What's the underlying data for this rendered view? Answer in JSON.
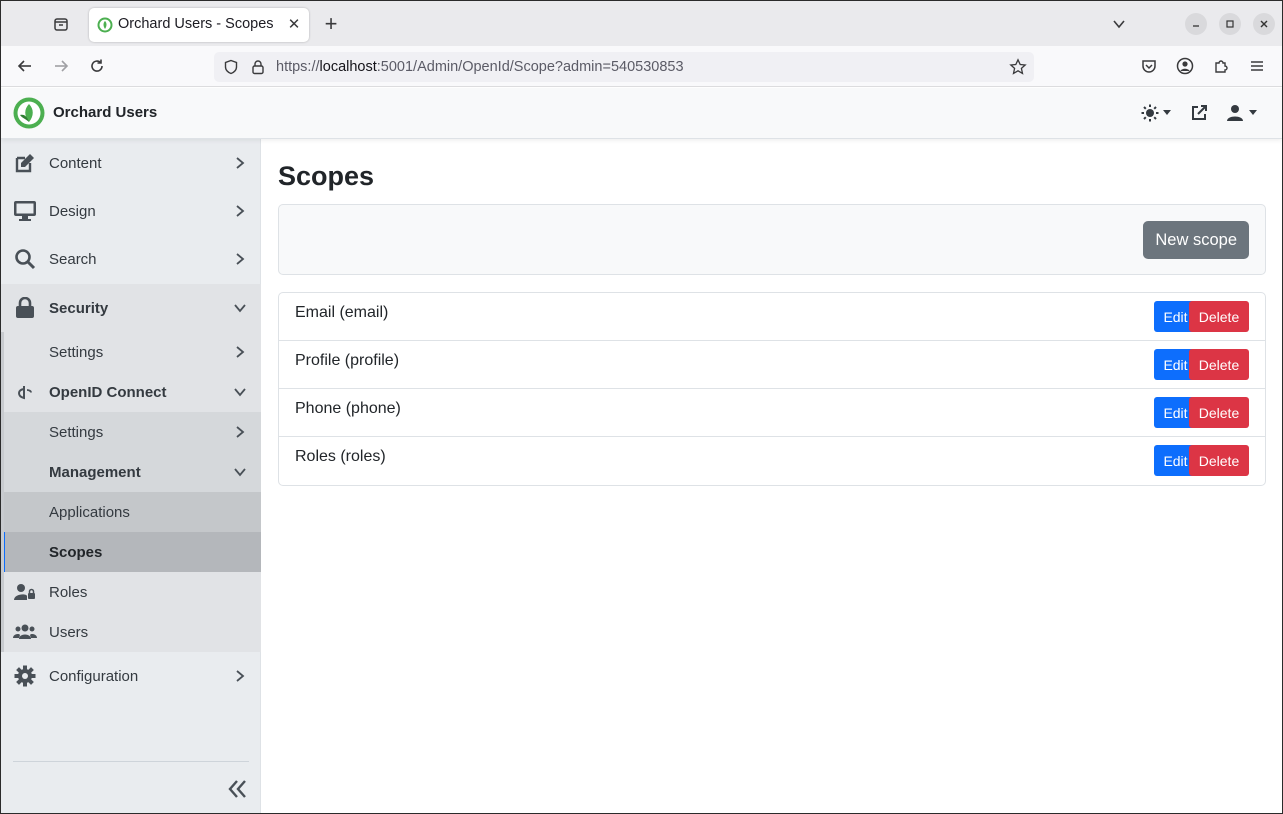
{
  "browser": {
    "tab_title": "Orchard Users - Scopes",
    "tab_close": "✕",
    "new_tab": "+",
    "url_prefix": "https://",
    "url_host": "localhost",
    "url_rest": ":5001/Admin/OpenId/Scope?admin=540530853"
  },
  "header": {
    "brand": "Orchard Users"
  },
  "sidebar": {
    "content": "Content",
    "design": "Design",
    "search": "Search",
    "security": "Security",
    "security_settings": "Settings",
    "openid": "OpenID Connect",
    "openid_settings": "Settings",
    "management": "Management",
    "applications": "Applications",
    "scopes": "Scopes",
    "roles": "Roles",
    "users": "Users",
    "configuration": "Configuration"
  },
  "main": {
    "title": "Scopes",
    "new_button": "New scope",
    "edit_label": "Edit",
    "delete_label": "Delete",
    "scopes": [
      {
        "name": "Email (email)"
      },
      {
        "name": "Profile (profile)"
      },
      {
        "name": "Phone (phone)"
      },
      {
        "name": "Roles (roles)"
      }
    ]
  },
  "colors": {
    "primary": "#0d6efd",
    "danger": "#dc3545",
    "secondary": "#6c757d",
    "brand_green": "#4caf50"
  }
}
